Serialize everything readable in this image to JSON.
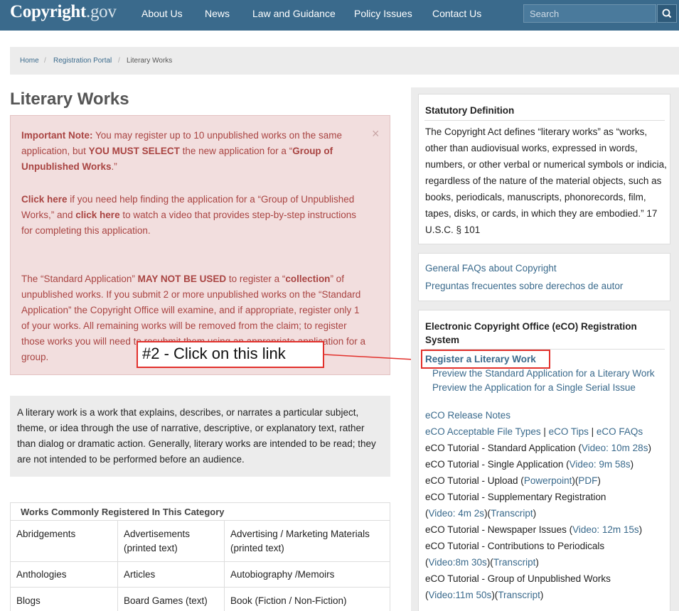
{
  "nav": {
    "logo_main": "Copyright",
    "logo_suffix": ".gov",
    "links": [
      "About Us",
      "News",
      "Law and Guidance",
      "Policy Issues",
      "Contact Us"
    ],
    "search_placeholder": "Search"
  },
  "breadcrumb": [
    "Home",
    "Registration Portal",
    "Literary Works"
  ],
  "page_title": "Literary Works",
  "alert": {
    "p1_bold": "Important Note:",
    "p1_text1": " You may register up to 10 unpublished works on the same application, but ",
    "p1_bold2": "YOU MUST SELECT",
    "p1_text2": " the new application for a “",
    "p1_bold3": "Group of Unpublished Works",
    "p1_text3": ".”",
    "p2_bold1": "Click here",
    "p2_text1": " if you need help finding the application for a “Group of Unpublished Works,” and ",
    "p2_bold2": "click here",
    "p2_text2": " to watch a video that provides step-by-step instructions for completing this application.",
    "p3_text1": "The “Standard Application” ",
    "p3_bold1": "MAY NOT BE USED",
    "p3_text2": " to register a “",
    "p3_bold2": "collection",
    "p3_text3": "” of unpublished works. If you submit 2 or more unpublished works on the “Standard Application” the Copyright Office will examine, and if appropriate, register only 1 of your works. All remaining works will be removed from the claim; to register those works you will need to resubmit them using an appropriate application for a group.",
    "close": "×"
  },
  "annotation": "#2 - Click on this link",
  "description": "A literary work is a work that explains, describes, or narrates a particular subject, theme, or idea through the use of narrative, descriptive, or explanatory text, rather than dialog or dramatic action. Generally, literary works are intended to be read; they are not intended to be performed before an audience.",
  "works": {
    "heading": "Works Commonly Registered In This Category",
    "rows": [
      [
        "Abridgements",
        "Advertisements (printed text)",
        "Advertising / Marketing Materials (printed text)"
      ],
      [
        "Anthologies",
        "Articles",
        "Autobiography /Memoirs"
      ],
      [
        "Blogs",
        "Board Games (text)",
        "Book (Fiction / Non-Fiction)"
      ]
    ]
  },
  "statutory": {
    "title": "Statutory Definition",
    "text": "The Copyright Act defines “literary works” as “works, other than audiovisual works, expressed in words, numbers, or other verbal or numerical symbols or indicia, regardless of the nature of the material objects, such as books, periodicals, manuscripts, phonorecords, film, tapes, disks, or cards, in which they are embodied.” 17 U.S.C. § 101"
  },
  "faqs": [
    "General FAQs about Copyright",
    "Preguntas frecuentes sobre derechos de autor"
  ],
  "eco": {
    "title": "Electronic Copyright Office (eCO) Registration System",
    "register": "Register a Literary Work",
    "preview1": "Preview the Standard Application for a Literary Work",
    "preview2": "Preview the Application for a Single Serial Issue",
    "release_notes": "eCO Release Notes",
    "file_types": "eCO Acceptable File Types",
    "tips": "eCO Tips",
    "faqs": "eCO FAQs",
    "sep": " | ",
    "t1": "eCO Tutorial - Standard Application (",
    "t1_link": "Video: 10m 28s",
    "t2": "eCO Tutorial - Single Application (",
    "t2_link": "Video: 9m 58s",
    "t3": "eCO Tutorial - Upload (",
    "t3_link1": "Powerpoint",
    "t3_link2": "PDF",
    "t4": "eCO Tutorial - Supplementary Registration",
    "t4_link1": "Video: 4m 2s",
    "t4_link2": "Transcript",
    "t5": "eCO Tutorial - Newspaper Issues (",
    "t5_link": "Video: 12m 15s",
    "t6": "eCO Tutorial - Contributions to Periodicals",
    "t6_link1": "Video:8m 30s",
    "t6_link2": "Transcript",
    "t7": "eCO Tutorial - Group of Unpublished Works",
    "t7_link1": "Video:11m 50s",
    "t7_link2": "Transcript",
    "close_paren": ")",
    "mid_paren": ")(",
    "open_paren": "("
  }
}
